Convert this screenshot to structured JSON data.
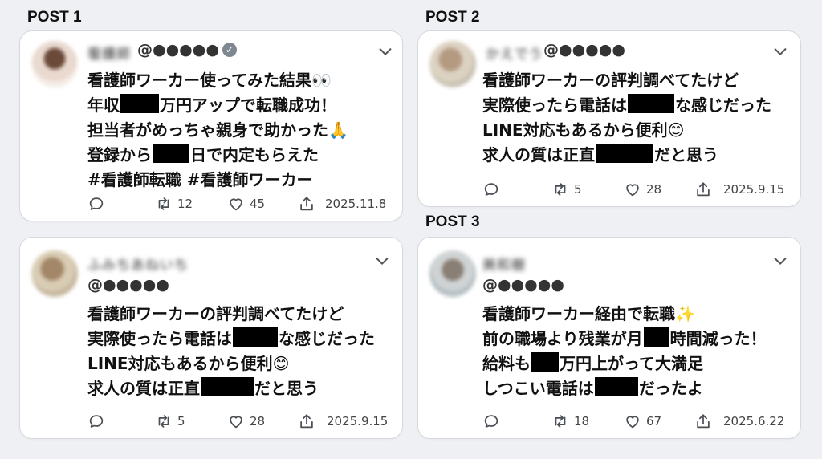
{
  "labels": {
    "post1": "POST 1",
    "post2": "POST 2",
    "post3": "POST 3"
  },
  "cards": [
    {
      "name": "看護師",
      "handle": "@●●●●●",
      "verified": "✓",
      "lines": [
        {
          "a": "看護師ワーカー使ってみた結果👀",
          "b": "",
          "c": ""
        },
        {
          "a": "年収",
          "b": "万円アップで転職成功！",
          "c": ""
        },
        {
          "a": "担当者がめっちゃ親身で助かった🙏",
          "b": "",
          "c": ""
        },
        {
          "a": "登録から",
          "b": "日で内定もらえた",
          "c": ""
        },
        {
          "a": "#看護師転職 #看護師ワーカー",
          "b": "",
          "c": ""
        }
      ],
      "retweets": "12",
      "likes": "45",
      "date": "2025.11.8"
    },
    {
      "name": "かえでう",
      "handle": "@●●●●●",
      "lines": [
        {
          "a": "看護師ワーカーの評判調べてたけど",
          "b": ""
        },
        {
          "a": "実際使ったら電話は",
          "b": "な感じだった"
        },
        {
          "a": "LINE対応もあるから便利😊",
          "b": ""
        },
        {
          "a": "求人の質は正直",
          "b": "だと思う"
        }
      ],
      "retweets": "5",
      "likes": "28",
      "date": "2025.9.15"
    },
    {
      "name": "ふみちあねいち",
      "handle": "@●●●●●",
      "lines": [
        {
          "a": "看護師ワーカーの評判調べてたけど",
          "b": ""
        },
        {
          "a": "実際使ったら電話は",
          "b": "な感じだった"
        },
        {
          "a": "LINE対応もあるから便利😊",
          "b": ""
        },
        {
          "a": "求人の質は正直",
          "b": "だと思う"
        }
      ],
      "retweets": "5",
      "likes": "28",
      "date": "2025.9.15"
    },
    {
      "name": "美和樹",
      "handle": "@●●●●●",
      "lines": [
        {
          "a": "看護師ワーカー経由で転職✨",
          "b": "",
          "c": ""
        },
        {
          "a": "前の職場より残業が月",
          "b": "時間減った！",
          "c": ""
        },
        {
          "a": "給料も",
          "b": "万円上がって大満足",
          "c": ""
        },
        {
          "a": "しつこい電話は",
          "b": "だったよ",
          "c": ""
        }
      ],
      "retweets": "18",
      "likes": "67",
      "date": "2025.6.22"
    }
  ]
}
